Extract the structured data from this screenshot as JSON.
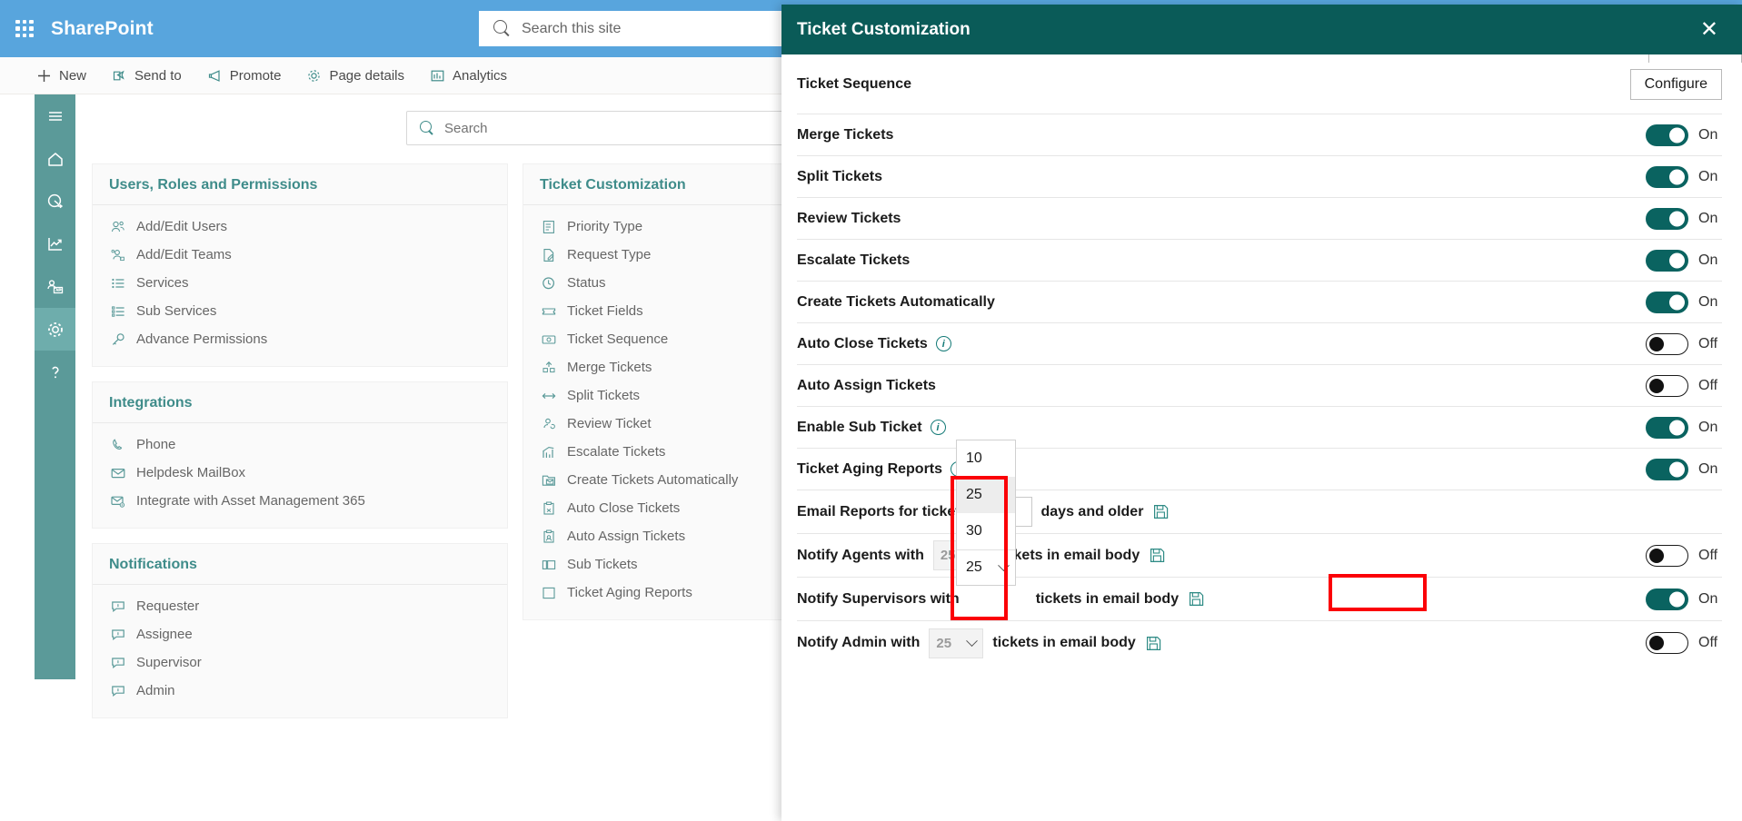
{
  "suite": {
    "brand": "SharePoint",
    "waffle_icon": "app-launcher-icon",
    "search_placeholder": "Search this site",
    "search_icon": "search-icon"
  },
  "commandbar": {
    "items": [
      {
        "label": "New",
        "icon": "plus-icon"
      },
      {
        "label": "Send to",
        "icon": "send-icon"
      },
      {
        "label": "Promote",
        "icon": "megaphone-icon"
      },
      {
        "label": "Page details",
        "icon": "gear-icon"
      },
      {
        "label": "Analytics",
        "icon": "bar-chart-icon"
      }
    ]
  },
  "rail": {
    "items": [
      {
        "name": "menu",
        "icon": "hamburger-icon",
        "active": false
      },
      {
        "name": "home",
        "icon": "home-icon",
        "active": false
      },
      {
        "name": "dashboard",
        "icon": "gauge-icon",
        "active": false
      },
      {
        "name": "reports",
        "icon": "trend-chart-icon",
        "active": false
      },
      {
        "name": "agents",
        "icon": "people-board-icon",
        "active": false
      },
      {
        "name": "settings",
        "icon": "gear-icon",
        "active": true
      },
      {
        "name": "help",
        "icon": "question-mark-icon",
        "active": false
      }
    ]
  },
  "page": {
    "search_placeholder": "Search",
    "search_icon": "search-icon",
    "cards": [
      {
        "title": "Users, Roles and Permissions",
        "items": [
          {
            "label": "Add/Edit Users",
            "icon": "users-icon"
          },
          {
            "label": "Add/Edit Teams",
            "icon": "team-icon"
          },
          {
            "label": "Services",
            "icon": "list-icon"
          },
          {
            "label": "Sub Services",
            "icon": "sub-list-icon"
          },
          {
            "label": "Advance Permissions",
            "icon": "key-icon"
          }
        ]
      },
      {
        "title": "Integrations",
        "items": [
          {
            "label": "Phone",
            "icon": "phone-icon"
          },
          {
            "label": "Helpdesk MailBox",
            "icon": "mail-icon"
          },
          {
            "label": "Integrate with Asset Management 365",
            "icon": "mail-gear-icon"
          }
        ]
      },
      {
        "title": "Notifications",
        "items": [
          {
            "label": "Requester",
            "icon": "comment-icon"
          },
          {
            "label": "Assignee",
            "icon": "comment-icon"
          },
          {
            "label": "Supervisor",
            "icon": "comment-icon"
          },
          {
            "label": "Admin",
            "icon": "comment-icon"
          }
        ]
      },
      {
        "title": "Ticket Customization",
        "items": [
          {
            "label": "Priority Type",
            "icon": "priority-list-icon"
          },
          {
            "label": "Request Type",
            "icon": "document-edit-icon"
          },
          {
            "label": "Status",
            "icon": "clock-check-icon"
          },
          {
            "label": "Ticket Fields",
            "icon": "ticket-icon"
          },
          {
            "label": "Ticket Sequence",
            "icon": "sequence-icon"
          },
          {
            "label": "Merge Tickets",
            "icon": "merge-icon"
          },
          {
            "label": "Split Tickets",
            "icon": "split-arrows-icon"
          },
          {
            "label": "Review Ticket",
            "icon": "people-refresh-icon"
          },
          {
            "label": "Escalate Tickets",
            "icon": "escalate-chart-icon"
          },
          {
            "label": "Create Tickets Automatically",
            "icon": "folder-mail-icon"
          },
          {
            "label": "Auto Close Tickets",
            "icon": "clipboard-close-icon"
          },
          {
            "label": "Auto Assign Tickets",
            "icon": "clipboard-assign-icon"
          },
          {
            "label": "Sub Tickets",
            "icon": "sub-tickets-icon"
          },
          {
            "label": "Ticket Aging Reports",
            "icon": "aging-report-icon"
          }
        ]
      }
    ]
  },
  "panel": {
    "title": "Ticket Customization",
    "close_icon": "close-icon",
    "ticket_sequence": {
      "label": "Ticket Sequence",
      "button": "Configure"
    },
    "toggle_rows": [
      {
        "label": "Merge Tickets",
        "state": "On",
        "on": true,
        "info": false
      },
      {
        "label": "Split Tickets",
        "state": "On",
        "on": true,
        "info": false
      },
      {
        "label": "Review Tickets",
        "state": "On",
        "on": true,
        "info": false
      },
      {
        "label": "Escalate Tickets",
        "state": "On",
        "on": true,
        "info": false
      },
      {
        "label": "Create Tickets Automatically",
        "state": "On",
        "on": true,
        "info": false
      },
      {
        "label": "Auto Close Tickets",
        "state": "Off",
        "on": false,
        "info": true
      },
      {
        "label": "Auto Assign Tickets",
        "state": "Off",
        "on": false,
        "info": false
      },
      {
        "label": "Enable Sub Ticket",
        "state": "On",
        "on": true,
        "info": true
      },
      {
        "label": "Ticket Aging Reports",
        "state": "On",
        "on": true,
        "info": true
      }
    ],
    "email_reports": {
      "prefix": "Email Reports for tickets",
      "value": "",
      "suffix": "days and older",
      "save_icon": "save-icon"
    },
    "notify_rows": [
      {
        "prefix": "Notify Agents with",
        "value": "25",
        "suffix": "tickets in email body",
        "save_icon": "save-icon",
        "state": "Off",
        "on": false
      },
      {
        "prefix": "Notify Supervisors with",
        "value": "25",
        "suffix": "tickets in email body",
        "save_icon": "save-icon",
        "state": "On",
        "on": true
      },
      {
        "prefix": "Notify Admin with",
        "value": "25",
        "suffix": "tickets in email body",
        "save_icon": "save-icon",
        "state": "Off",
        "on": false
      }
    ],
    "open_dropdown": {
      "options": [
        "10",
        "25",
        "30"
      ],
      "highlighted": "25",
      "selected_value": "25",
      "chevron_icon": "chevron-down-icon"
    },
    "highlight_color": "#fb0007",
    "accent_color": "#0a5b58",
    "toggle_on_color": "#0a6360"
  }
}
